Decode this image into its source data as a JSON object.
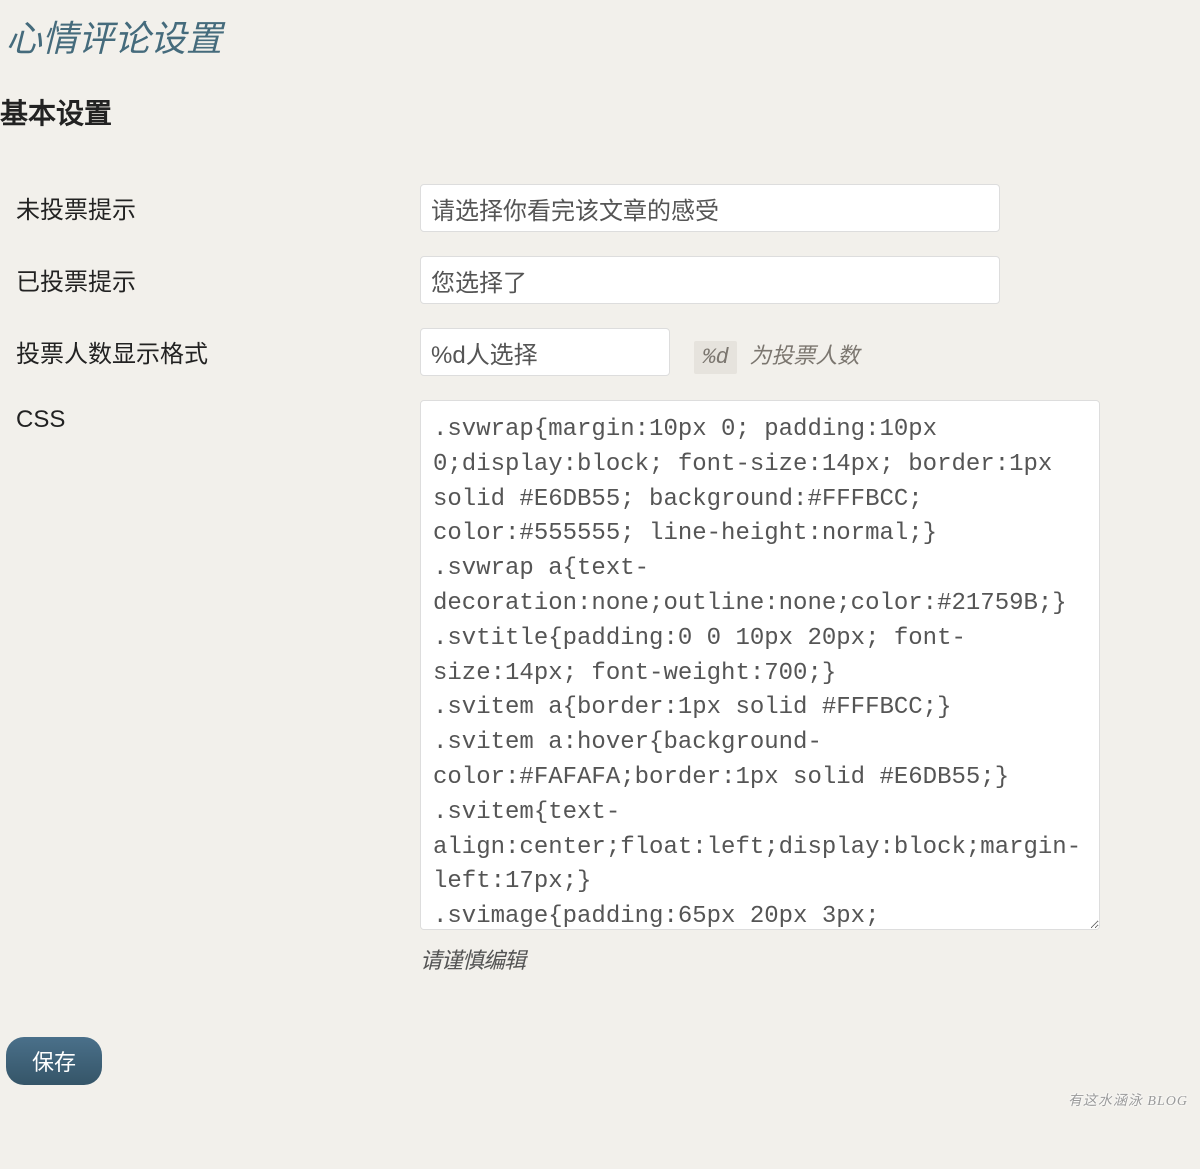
{
  "page_title": "心情评论设置",
  "section_heading": "基本设置",
  "fields": {
    "not_voted": {
      "label": "未投票提示",
      "value": "请选择你看完该文章的感受"
    },
    "voted": {
      "label": "已投票提示",
      "value": "您选择了"
    },
    "count_format": {
      "label": "投票人数显示格式",
      "value": "%d人选择",
      "hint_code": "%d",
      "hint_text": "为投票人数"
    },
    "css": {
      "label": "CSS",
      "value": ".svwrap{margin:10px 0; padding:10px 0;display:block; font-size:14px; border:1px solid #E6DB55; background:#FFFBCC; color:#555555; line-height:normal;}\n.svwrap a{text-decoration:none;outline:none;color:#21759B;}\n.svtitle{padding:0 0 10px 20px; font-size:14px; font-weight:700;}\n.svitem a{border:1px solid #FFFBCC;}\n.svitem a:hover{background-color:#FAFAFA;border:1px solid #E6DB55;}\n.svitem{text-align:center;float:left;display:block;margin-left:17px;}\n.svimage{padding:65px 20px 3px;",
      "hint": "请谨慎编辑"
    }
  },
  "save_button": "保存",
  "watermark": "有这水涵泳\nBLOG"
}
